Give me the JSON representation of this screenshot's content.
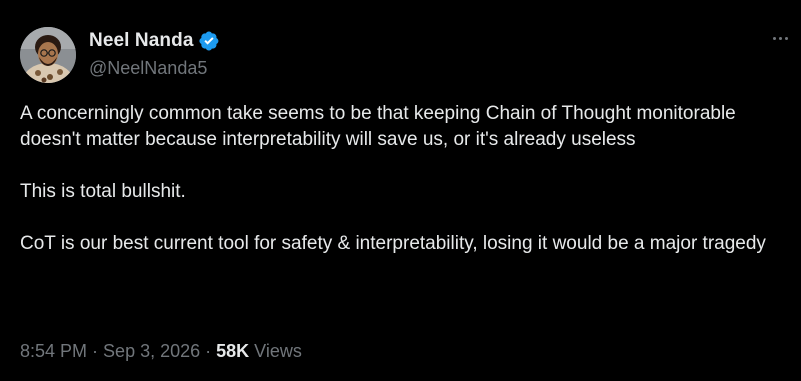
{
  "author": {
    "display_name": "Neel Nanda",
    "handle": "@NeelNanda5",
    "verified_icon": "verified-badge-icon",
    "avatar": "avatar"
  },
  "tweet": {
    "paragraphs": [
      "A concerningly common take seems to be that keeping Chain of Thought monitorable doesn't matter because interpretability will save us, or it's already useless",
      "This is total bullshit.",
      "CoT is our best current tool for safety & interpretability, losing it would be a major tragedy"
    ]
  },
  "meta": {
    "time": "8:54 PM",
    "separator": "·",
    "date": "Sep 3, 2026",
    "views_count": "58K",
    "views_label": "Views"
  },
  "icons": {
    "more": "more-options-icon"
  },
  "colors": {
    "background": "#000000",
    "text_primary": "#e7e9ea",
    "text_secondary": "#71767b",
    "verified_blue": "#1d9bf0"
  }
}
